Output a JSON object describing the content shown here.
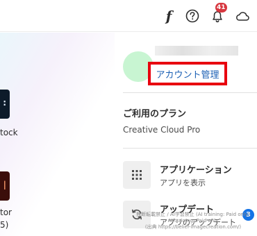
{
  "header": {
    "font_icon_glyph": "f",
    "notification_count": "41"
  },
  "left": {
    "apps": [
      {
        "label": "tock"
      },
      {
        "label_line1": "tor",
        "label_line2": "5)"
      }
    ]
  },
  "panel": {
    "account_link": "アカウント管理",
    "plan_title": "ご利用のプラン",
    "plan_name": "Creative Cloud Pro",
    "menu": [
      {
        "title": "アプリケーション",
        "subtitle": "アプリを表示",
        "icon": "grid-icon"
      },
      {
        "title": "アップデート",
        "subtitle": "アプリのアップデート",
        "icon": "refresh-icon",
        "badge": "3"
      }
    ]
  },
  "watermark": {
    "line1": "無断転載禁止 / AI学習禁止 (AI training: Paid only)",
    "line2": "AI training: Paid only",
    "line3": "(出典 https://belief-imagecreation.com/)"
  },
  "colors": {
    "highlight_border": "#e8000f",
    "link": "#1a5fb4",
    "badge_red": "#d7373f",
    "badge_blue": "#1473e6",
    "avatar": "#c8f5d2"
  }
}
